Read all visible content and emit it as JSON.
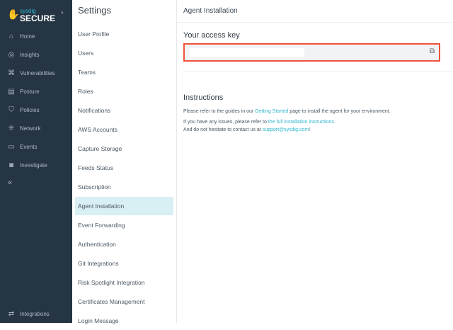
{
  "nav": {
    "brand_top": "sysdig",
    "brand_bottom": "SECURE",
    "items": [
      {
        "label": "Home",
        "icon": "home-icon"
      },
      {
        "label": "Insights",
        "icon": "insights-icon"
      },
      {
        "label": "Vulnerabilities",
        "icon": "bug-icon"
      },
      {
        "label": "Posture",
        "icon": "posture-icon"
      },
      {
        "label": "Policies",
        "icon": "shield-icon"
      },
      {
        "label": "Network",
        "icon": "network-icon"
      },
      {
        "label": "Events",
        "icon": "events-icon"
      },
      {
        "label": "Investigate",
        "icon": "investigate-icon"
      }
    ],
    "integrations": "Integrations"
  },
  "settings": {
    "title": "Settings",
    "items": [
      "User Profile",
      "Users",
      "Teams",
      "Roles",
      "Notifications",
      "AWS Accounts",
      "Capture Storage",
      "Feeds Status",
      "Subscription",
      "Agent Installation",
      "Event Forwarding",
      "Authentication",
      "Git Integrations",
      "Risk Spotlight Integration",
      "Certificates Management",
      "Login Message"
    ],
    "active": "Agent Installation"
  },
  "main": {
    "title": "Agent Installation",
    "access_key_label": "Your access key",
    "instructions_title": "Instructions",
    "p1_a": "Please refer to the guides in our ",
    "p1_link": "Getting Started",
    "p1_b": " page to install the agent for your environment.",
    "p2_a": "If you have any issues, please refer to ",
    "p2_link": "the full installation instructions",
    "p2_b": ".",
    "p3_a": "And do not hesitate to contact us at ",
    "p3_link": "support@sysdig.com",
    "p3_b": "!"
  }
}
